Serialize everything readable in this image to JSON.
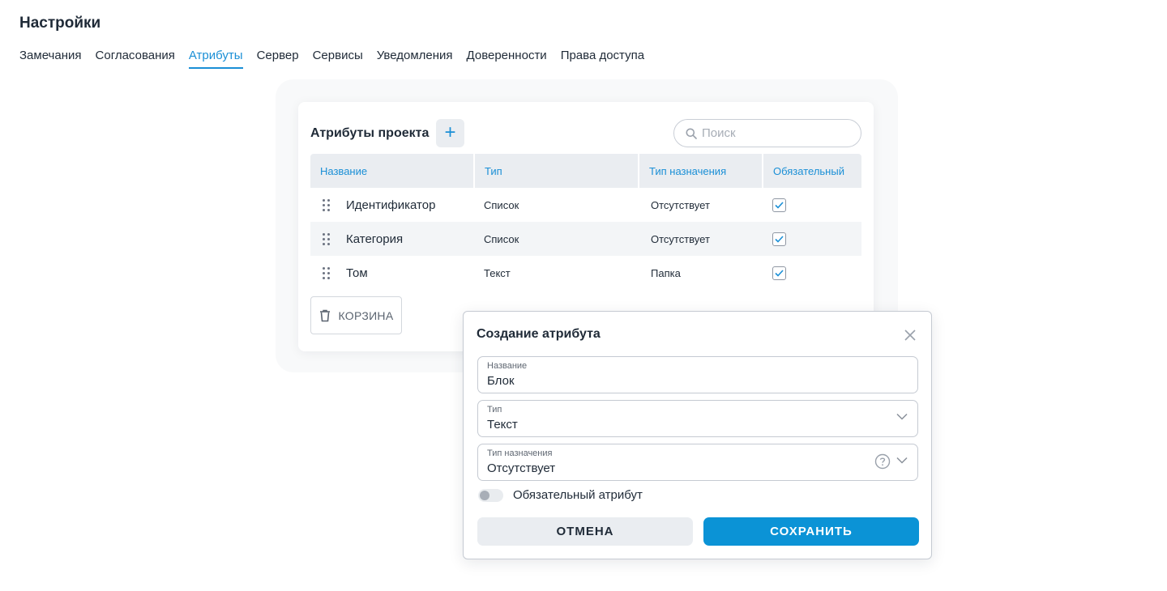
{
  "page": {
    "title": "Настройки"
  },
  "tabs": [
    {
      "label": "Замечания",
      "active": false
    },
    {
      "label": "Согласования",
      "active": false
    },
    {
      "label": "Атрибуты",
      "active": true
    },
    {
      "label": "Сервер",
      "active": false
    },
    {
      "label": "Сервисы",
      "active": false
    },
    {
      "label": "Уведомления",
      "active": false
    },
    {
      "label": "Доверенности",
      "active": false
    },
    {
      "label": "Права доступа",
      "active": false
    }
  ],
  "attributes": {
    "title": "Атрибуты проекта",
    "add_icon": "plus-icon",
    "search": {
      "placeholder": "Поиск",
      "value": "",
      "icon": "search-icon"
    },
    "columns": [
      "Название",
      "Тип",
      "Тип назначения",
      "Обязательный"
    ],
    "rows": [
      {
        "name": "Идентификатор",
        "type": "Список",
        "assignment": "Отсутствует",
        "required": true
      },
      {
        "name": "Категория",
        "type": "Список",
        "assignment": "Отсутствует",
        "required": true
      },
      {
        "name": "Том",
        "type": "Текст",
        "assignment": "Папка",
        "required": true
      }
    ],
    "trash_label": "КОРЗИНА",
    "trash_icon": "trash-icon"
  },
  "dialog": {
    "title": "Создание атрибута",
    "close_icon": "close-icon",
    "fields": {
      "name": {
        "label": "Название",
        "value": "Блок"
      },
      "type": {
        "label": "Тип",
        "value": "Текст"
      },
      "assignment": {
        "label": "Тип назначения",
        "value": "Отсутствует"
      }
    },
    "required_toggle": {
      "label": "Обязательный атрибут",
      "on": false
    },
    "cancel_label": "ОТМЕНА",
    "save_label": "СОХРАНИТЬ"
  },
  "colors": {
    "accent": "#1a8fd6",
    "save_button": "#0b93d6",
    "header_bg": "#eaedf1"
  }
}
